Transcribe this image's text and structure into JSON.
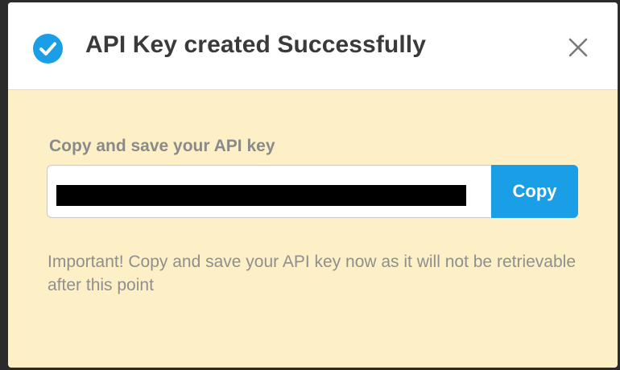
{
  "modal": {
    "title": "API Key created Successfully",
    "icons": {
      "status": "check-circle-icon",
      "close": "close-icon"
    },
    "colors": {
      "accent": "#1a9ee6",
      "body_background": "#fdf0c7",
      "header_background": "#ffffff"
    }
  },
  "body": {
    "field_label": "Copy and save your API key",
    "api_key_value_redacted": true,
    "copy_button_label": "Copy",
    "warning": "Important! Copy and save your API key now as it will not be retrievable after this point"
  }
}
